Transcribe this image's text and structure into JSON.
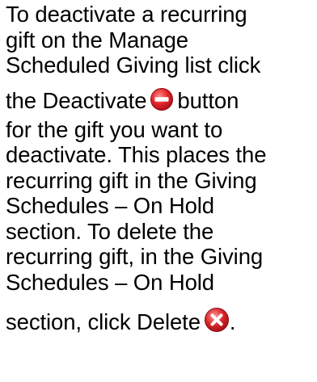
{
  "instruction": {
    "lines": [
      "To deactivate a recurring",
      "gift on the Manage",
      "Scheduled Giving list click",
      "the Deactivate",
      "button",
      "for the gift you want to",
      "deactivate. This places the",
      "recurring gift in the Giving",
      "Schedules – On Hold",
      "section. To delete the",
      "recurring gift, in the Giving",
      "Schedules – On Hold",
      "section, click Delete",
      "."
    ],
    "icons": {
      "deactivate": "deactivate-icon",
      "delete": "delete-icon"
    },
    "colors": {
      "deactivate_icon": "#e0242a",
      "delete_icon": "#d7262b"
    }
  }
}
